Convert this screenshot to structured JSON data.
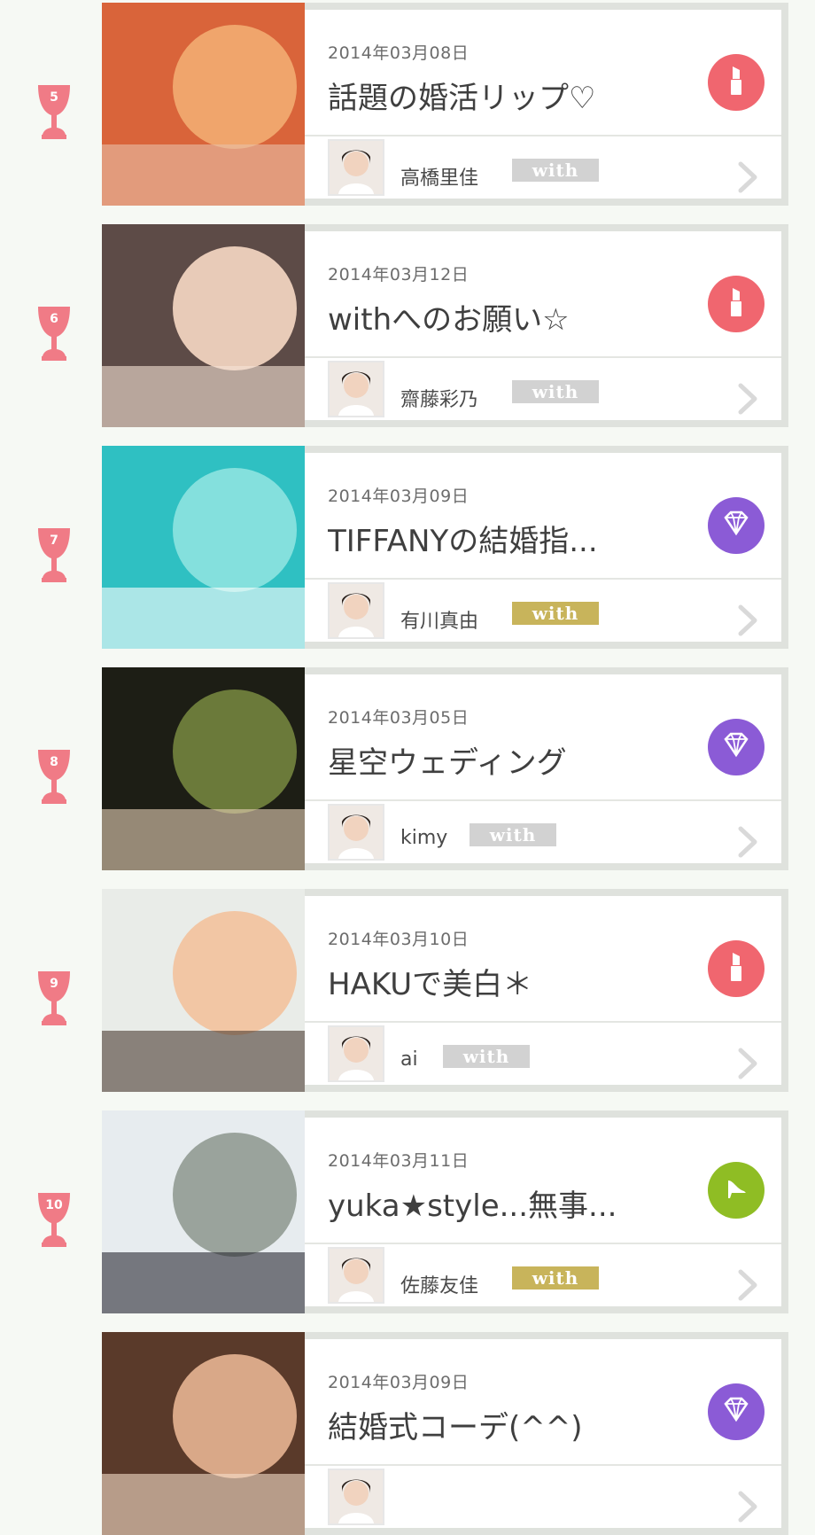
{
  "colors": {
    "rank_pink": "#f07b86",
    "lipstick_category": "#f0666f",
    "diamond_category": "#8b5bd6",
    "shoe_category": "#8fbd24",
    "badge_gold": "#c8b45b",
    "badge_gray": "#d2d2d2"
  },
  "items": [
    {
      "rank": "5",
      "date": "2014年03月08日",
      "title": "話題の婚活リップ♡",
      "author": "高橋里佳",
      "badge": "with",
      "badge_style": "gray",
      "category": "lipstick-icon"
    },
    {
      "rank": "6",
      "date": "2014年03月12日",
      "title": "withへのお願い☆",
      "author": "齋藤彩乃",
      "badge": "with",
      "badge_style": "gray",
      "category": "lipstick-icon"
    },
    {
      "rank": "7",
      "date": "2014年03月09日",
      "title": "TIFFANYの結婚指...",
      "author": "有川真由",
      "badge": "with",
      "badge_style": "gold",
      "category": "diamond-icon"
    },
    {
      "rank": "8",
      "date": "2014年03月05日",
      "title": "星空ウェディング",
      "author": "kimy",
      "badge": "with",
      "badge_style": "gray",
      "category": "diamond-icon"
    },
    {
      "rank": "9",
      "date": "2014年03月10日",
      "title": "HAKUで美白＊",
      "author": "ai",
      "badge": "with",
      "badge_style": "gray",
      "category": "lipstick-icon"
    },
    {
      "rank": "10",
      "date": "2014年03月11日",
      "title": "yuka★style...無事...",
      "author": "佐藤友佳",
      "badge": "with",
      "badge_style": "gold",
      "category": "shoe-icon"
    },
    {
      "rank": "",
      "date": "2014年03月09日",
      "title": "結婚式コーデ(^^)",
      "author": "",
      "badge": "",
      "badge_style": "gray",
      "category": "diamond-icon"
    }
  ]
}
